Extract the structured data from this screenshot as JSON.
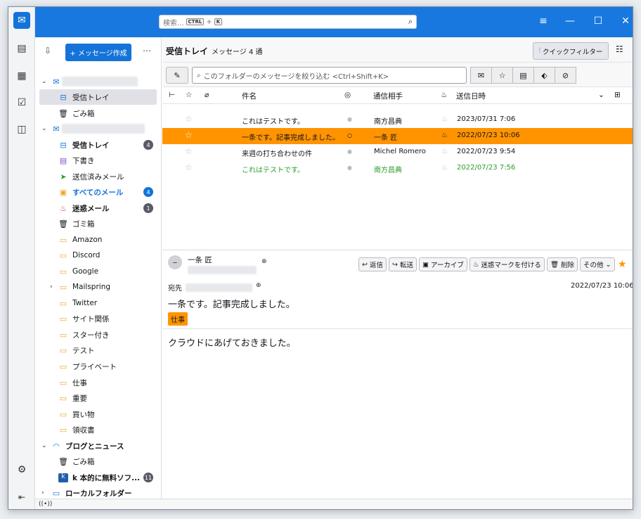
{
  "spaces": {
    "items": [
      {
        "name": "mail-icon",
        "glyph": "✉"
      },
      {
        "name": "address-book-icon",
        "glyph": "📇"
      },
      {
        "name": "calendar-icon",
        "glyph": "▦"
      },
      {
        "name": "tasks-icon",
        "glyph": "☑"
      },
      {
        "name": "chat-icon",
        "glyph": "💬"
      }
    ],
    "settings_glyph": "⚙",
    "collapse_glyph": "|←"
  },
  "titlebar": {
    "search_placeholder": "検索...",
    "kbd_ctrl": "CTRL",
    "kbd_plus": "+",
    "kbd_k": "K"
  },
  "folder_pane": {
    "new_message": "+ メッセージ作成",
    "accounts": [
      {
        "folders": [
          {
            "label": "受信トレイ"
          },
          {
            "label": "ごみ箱"
          }
        ]
      },
      {
        "folders": [
          {
            "label": "受信トレイ",
            "count": "4"
          },
          {
            "label": "下書き"
          },
          {
            "label": "送信済みメール"
          },
          {
            "label": "すべてのメール",
            "count": "4"
          },
          {
            "label": "迷惑メール",
            "count": "1"
          },
          {
            "label": "ゴミ箱"
          },
          {
            "label": "Amazon"
          },
          {
            "label": "Discord"
          },
          {
            "label": "Google"
          },
          {
            "label": "Mailspring"
          },
          {
            "label": "Twitter"
          },
          {
            "label": "サイト関係"
          },
          {
            "label": "スター付き"
          },
          {
            "label": "テスト"
          },
          {
            "label": "プライベート"
          },
          {
            "label": "仕事"
          },
          {
            "label": "重要"
          },
          {
            "label": "買い物"
          },
          {
            "label": "領収書"
          }
        ]
      }
    ],
    "blogs": {
      "label": "ブログとニュース",
      "trash": "ごみ箱",
      "feed": "k 本的に無料ソフ...",
      "feed_count": "11"
    },
    "local": {
      "label": "ローカルフォルダー"
    }
  },
  "list_header": {
    "title": "受信トレイ",
    "count": "メッセージ 4 通",
    "quick_filter": "クイックフィルター"
  },
  "filter": {
    "placeholder": "このフォルダーのメッセージを絞り込む <Ctrl+Shift+K>"
  },
  "columns": {
    "subject": "件名",
    "correspondent": "通信相手",
    "date": "送信日時"
  },
  "messages": [
    {
      "subject": "これはテストです。",
      "from": "南方昌典",
      "date": "2023/07/31 7:06"
    },
    {
      "subject": "一条です。記事完成しました。",
      "from": "一条 匠",
      "date": "2022/07/23 10:06"
    },
    {
      "subject": "来週の打ち合わせの件",
      "from": "Michel Romero",
      "date": "2022/07/23 9:54"
    },
    {
      "subject": "これはテストです。",
      "from": "南方昌典",
      "date": "2022/07/23 7:56"
    }
  ],
  "message_view": {
    "from": "一条 匠",
    "actions": [
      "返信",
      "転送",
      "アーカイブ",
      "迷惑マークを付ける",
      "削除",
      "その他"
    ],
    "to_label": "宛先",
    "date": "2022/07/23 10:06",
    "subject": "一条です。記事完成しました。",
    "tag": "仕事",
    "body": "クラウドにあげておきました。"
  },
  "colors": {
    "accent": "#1373d9",
    "selected_row": "#ff9400",
    "titlebar": "#1878e0",
    "green_text": "#2a9d2a"
  }
}
